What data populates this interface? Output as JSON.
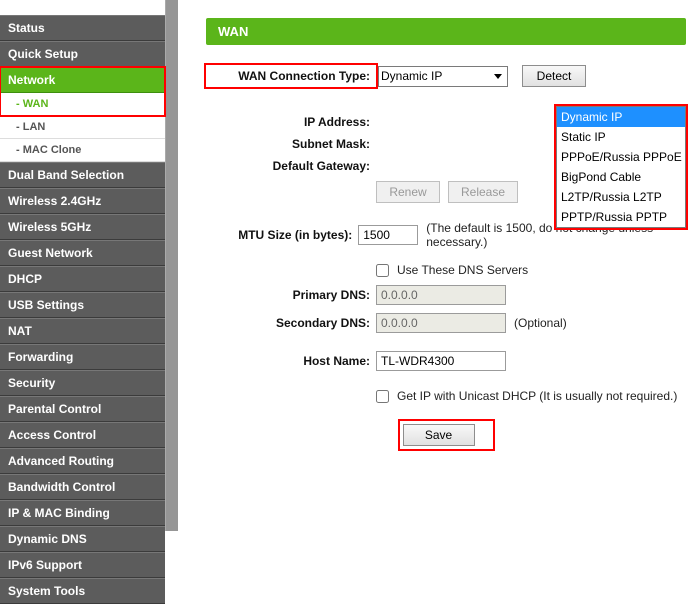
{
  "sidebar": {
    "items": [
      {
        "label": "Status",
        "type": "item"
      },
      {
        "label": "Quick Setup",
        "type": "item"
      },
      {
        "label": "Network",
        "type": "item",
        "active": true
      },
      {
        "label": "- WAN",
        "type": "sub",
        "active": true
      },
      {
        "label": "- LAN",
        "type": "sub"
      },
      {
        "label": "- MAC Clone",
        "type": "sub"
      },
      {
        "label": "Dual Band Selection",
        "type": "item"
      },
      {
        "label": "Wireless 2.4GHz",
        "type": "item"
      },
      {
        "label": "Wireless 5GHz",
        "type": "item"
      },
      {
        "label": "Guest Network",
        "type": "item"
      },
      {
        "label": "DHCP",
        "type": "item"
      },
      {
        "label": "USB Settings",
        "type": "item"
      },
      {
        "label": "NAT",
        "type": "item"
      },
      {
        "label": "Forwarding",
        "type": "item"
      },
      {
        "label": "Security",
        "type": "item"
      },
      {
        "label": "Parental Control",
        "type": "item"
      },
      {
        "label": "Access Control",
        "type": "item"
      },
      {
        "label": "Advanced Routing",
        "type": "item"
      },
      {
        "label": "Bandwidth Control",
        "type": "item"
      },
      {
        "label": "IP & MAC Binding",
        "type": "item"
      },
      {
        "label": "Dynamic DNS",
        "type": "item"
      },
      {
        "label": "IPv6 Support",
        "type": "item"
      },
      {
        "label": "System Tools",
        "type": "item"
      }
    ]
  },
  "page": {
    "title": "WAN"
  },
  "form": {
    "wan_conn_type_label": "WAN Connection Type:",
    "wan_conn_type_value": "Dynamic IP",
    "detect_btn": "Detect",
    "options": [
      "Dynamic IP",
      "Static IP",
      "PPPoE/Russia PPPoE",
      "BigPond Cable",
      "L2TP/Russia L2TP",
      "PPTP/Russia PPTP"
    ],
    "ip_address_label": "IP Address:",
    "subnet_mask_label": "Subnet Mask:",
    "default_gateway_label": "Default Gateway:",
    "renew_btn": "Renew",
    "release_btn": "Release",
    "mtu_label": "MTU Size (in bytes):",
    "mtu_value": "1500",
    "mtu_note": "(The default is 1500, do not change unless necessary.)",
    "use_dns_label": "Use These DNS Servers",
    "primary_dns_label": "Primary DNS:",
    "primary_dns_value": "0.0.0.0",
    "secondary_dns_label": "Secondary DNS:",
    "secondary_dns_value": "0.0.0.0",
    "secondary_dns_note": "(Optional)",
    "host_name_label": "Host Name:",
    "host_name_value": "TL-WDR4300",
    "unicast_label": "Get IP with Unicast DHCP (It is usually not required.)",
    "save_btn": "Save"
  }
}
